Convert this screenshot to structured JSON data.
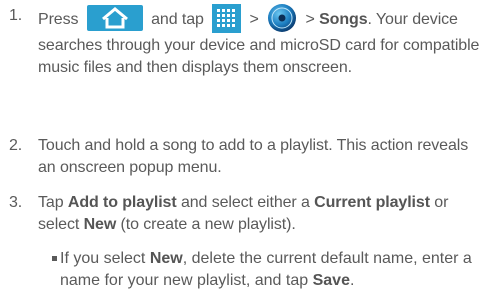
{
  "steps": [
    {
      "num": "1.",
      "text_press": "Press",
      "text_and_tap": "and tap",
      "gt1": ">",
      "gt2": ">",
      "songs": "Songs",
      "rest": ". Your device searches through your device and microSD card for compatible music files and then displays them onscreen."
    },
    {
      "num": "2.",
      "text": "Touch and hold a song to add to a playlist. This action reveals an onscreen popup menu."
    },
    {
      "num": "3.",
      "tap": "Tap",
      "add_to_playlist": "Add to playlist",
      "and_select": "and select either a",
      "current_playlist": "Current playlist",
      "or_select": "or select",
      "new": "New",
      "paren": "(to create a new playlist)."
    }
  ],
  "sub_bullet": {
    "if_you_select": "If you select",
    "new": "New",
    "middle": ", delete the current default name, enter a name for your new playlist, and tap",
    "save": "Save",
    "end": "."
  },
  "icons": {
    "home": "home-icon",
    "apps": "apps-grid-icon",
    "music": "music-player-icon",
    "accent_color": "#2a9fcf"
  }
}
